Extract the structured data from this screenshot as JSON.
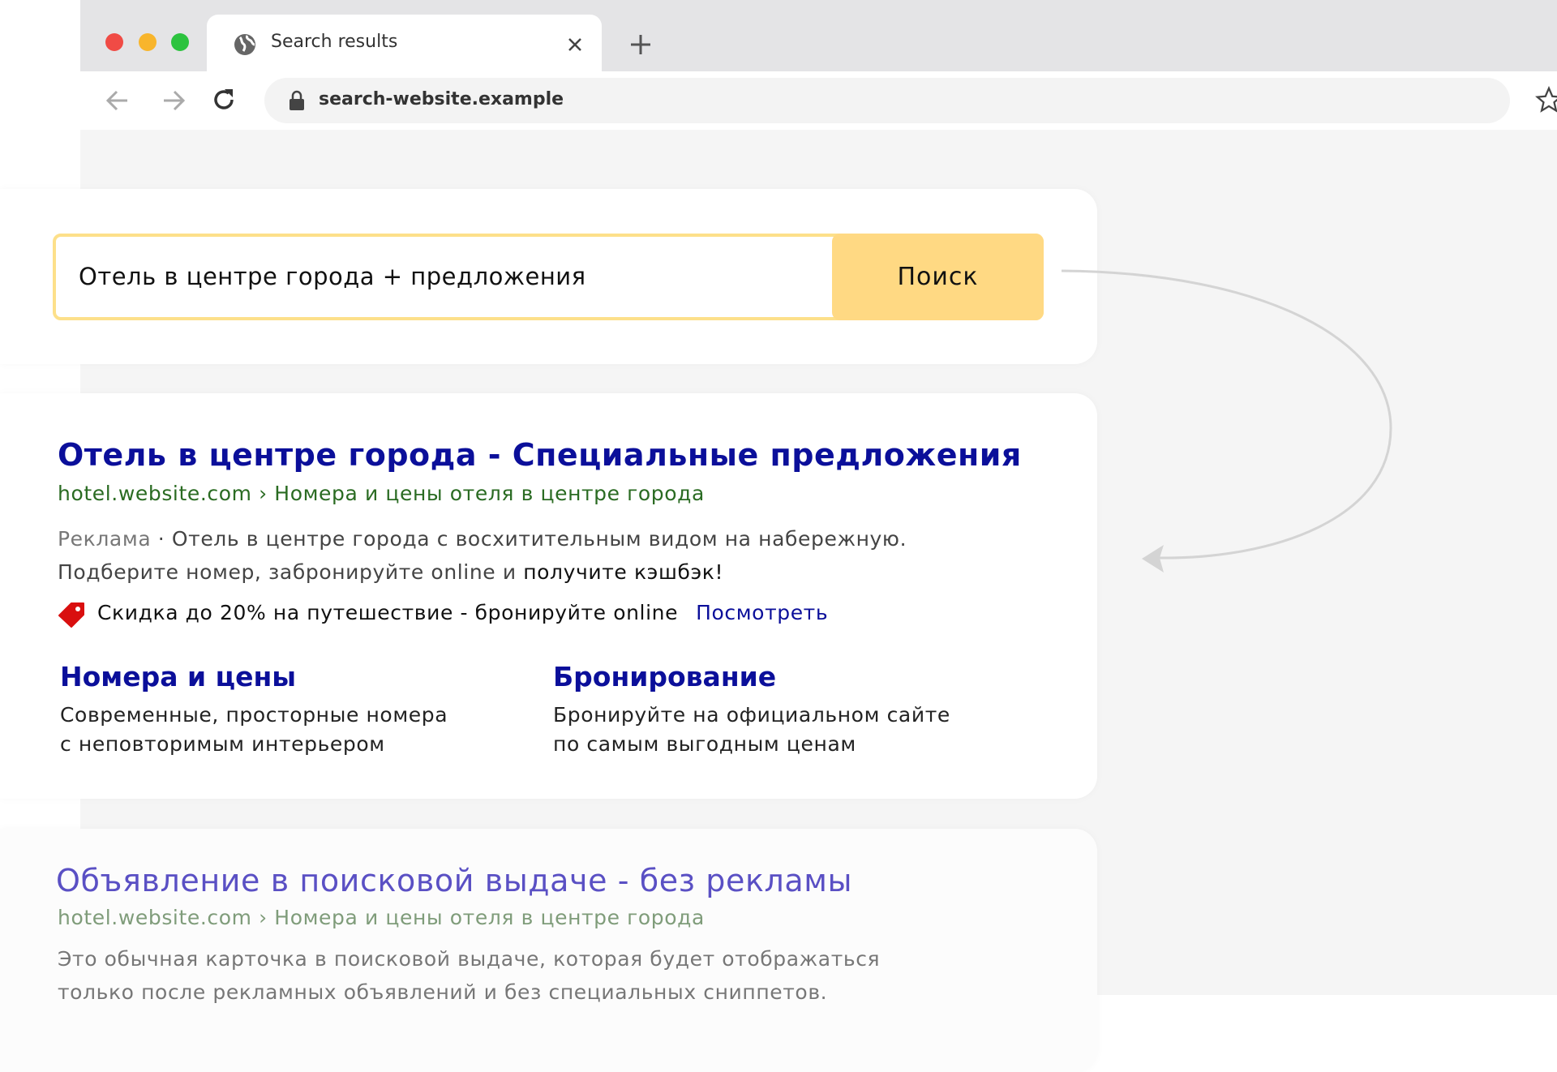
{
  "browser": {
    "traffic_lights": [
      "#f04b45",
      "#f8b52c",
      "#2cc33f"
    ],
    "tab": {
      "title": "Search results",
      "favicon": "globe-icon",
      "close": "close-icon"
    },
    "new_tab": "plus-icon",
    "address": {
      "url": "search-website.example",
      "lock": "lock-icon"
    }
  },
  "search": {
    "query": "Отель в центре города + предложения",
    "button": "Поиск",
    "accent": "#ffd983"
  },
  "ad": {
    "title": "Отель в центре города - Специальные предложения",
    "breadcrumb": "hotel.website.com › Номера и цены отеля в центре города",
    "label": "Реклама",
    "desc1": " · Отель в центре города с восхитительным видом на набережную.",
    "desc2a": "Подберите номер, забронируйте online и ",
    "desc2b": "получите кэшбэк!",
    "promo": "Скидка до 20% на путешествие - бронируйте online",
    "promo_link": "Посмотреть",
    "promo_icon": "tag-icon",
    "sitelinks": [
      {
        "title": "Номера и цены",
        "line1": "Современные, просторные номера",
        "line2": "с неповторимым интерьером"
      },
      {
        "title": "Бронирование",
        "line1": "Бронируйте на официальном сайте",
        "line2": "по самым выгодным ценам"
      }
    ]
  },
  "organic": {
    "title": "Объявление в поисковой выдаче - без рекламы",
    "breadcrumb": "hotel.website.com › Номера и цены отеля в центре города",
    "line1": "Это обычная карточка в поисковой выдаче, которая будет отображаться",
    "line2": "только после рекламных объявлений и без специальных сниппетов."
  }
}
